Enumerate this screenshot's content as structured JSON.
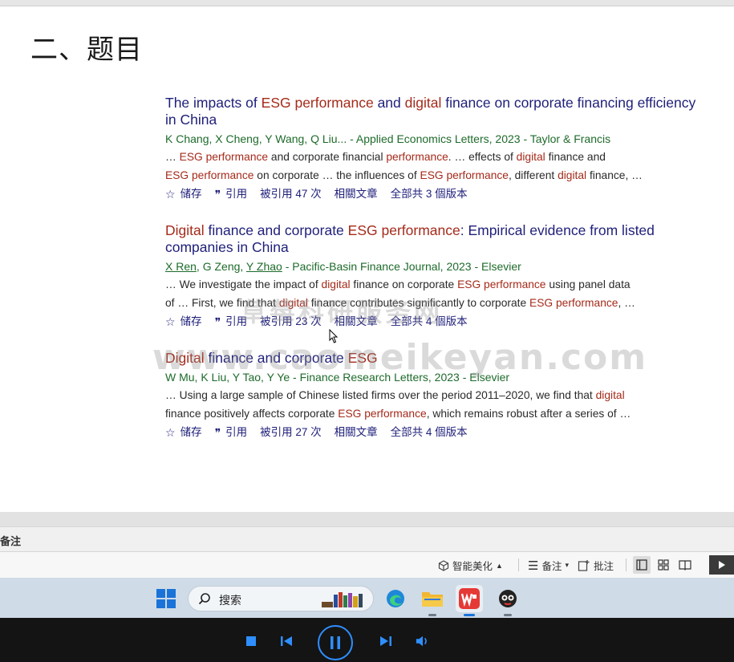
{
  "slide": {
    "title": "二、题目",
    "watermark_url": "www.caomeikeyan.com",
    "watermark_cn": "草莓科研服务网",
    "results": [
      {
        "title_parts": [
          {
            "t": "The impacts of ",
            "hl": false
          },
          {
            "t": "ESG performance",
            "hl": true
          },
          {
            "t": " and ",
            "hl": false
          },
          {
            "t": "digital",
            "hl": true
          },
          {
            "t": " finance on corporate financing efficiency in China",
            "hl": false
          }
        ],
        "authors_parts": [
          {
            "t": "K Chang, X Cheng, Y Wang, Q Liu... - Applied Economics Letters, 2023 - Taylor & Francis",
            "u": false
          }
        ],
        "snippet_line1": [
          {
            "t": "… ",
            "hl": false
          },
          {
            "t": "ESG performance",
            "hl": true
          },
          {
            "t": " and corporate financial ",
            "hl": false
          },
          {
            "t": "performance",
            "hl": true
          },
          {
            "t": ". … effects of ",
            "hl": false
          },
          {
            "t": "digital",
            "hl": true
          },
          {
            "t": " finance and",
            "hl": false
          }
        ],
        "snippet_line2": [
          {
            "t": "ESG performance",
            "hl": true
          },
          {
            "t": " on corporate … the influences of ",
            "hl": false
          },
          {
            "t": "ESG performance",
            "hl": true
          },
          {
            "t": ", different ",
            "hl": false
          },
          {
            "t": "digital",
            "hl": true
          },
          {
            "t": " finance, …",
            "hl": false
          }
        ],
        "links": {
          "save": "储存",
          "cite": "引用",
          "cited_by": "被引用 47 次",
          "related": "相關文章",
          "versions": "全部共 3 個版本"
        }
      },
      {
        "title_parts": [
          {
            "t": "Digital",
            "hl": true
          },
          {
            "t": " finance and corporate ",
            "hl": false
          },
          {
            "t": "ESG performance",
            "hl": true
          },
          {
            "t": ": Empirical evidence from listed companies in China",
            "hl": false
          }
        ],
        "authors_parts": [
          {
            "t": "X Ren",
            "u": true
          },
          {
            "t": ", G Zeng, ",
            "u": false
          },
          {
            "t": "Y Zhao",
            "u": true
          },
          {
            "t": " - Pacific-Basin Finance Journal, 2023 - Elsevier",
            "u": false
          }
        ],
        "snippet_line1": [
          {
            "t": "… We investigate the impact of ",
            "hl": false
          },
          {
            "t": "digital",
            "hl": true
          },
          {
            "t": " finance on corporate ",
            "hl": false
          },
          {
            "t": "ESG performance",
            "hl": true
          },
          {
            "t": " using panel data",
            "hl": false
          }
        ],
        "snippet_line2": [
          {
            "t": "of … First, we find that ",
            "hl": false
          },
          {
            "t": "digital",
            "hl": true
          },
          {
            "t": " finance contributes significantly to corporate ",
            "hl": false
          },
          {
            "t": "ESG performance",
            "hl": true
          },
          {
            "t": ", …",
            "hl": false
          }
        ],
        "links": {
          "save": "储存",
          "cite": "引用",
          "cited_by": "被引用 23 次",
          "related": "相關文章",
          "versions": "全部共 4 個版本"
        }
      },
      {
        "title_parts": [
          {
            "t": "Digital",
            "hl": true
          },
          {
            "t": " finance and corporate ",
            "hl": false
          },
          {
            "t": "ESG",
            "hl": true
          }
        ],
        "authors_parts": [
          {
            "t": "W Mu, K Liu, Y Tao, Y Ye - Finance Research Letters, 2023 - Elsevier",
            "u": false
          }
        ],
        "snippet_line1": [
          {
            "t": "… Using a large sample of Chinese listed firms over the period 2011–2020, we find that ",
            "hl": false
          },
          {
            "t": "digital",
            "hl": true
          }
        ],
        "snippet_line2": [
          {
            "t": "finance positively affects corporate ",
            "hl": false
          },
          {
            "t": "ESG performance",
            "hl": true
          },
          {
            "t": ", which remains robust after a series of …",
            "hl": false
          }
        ],
        "links": {
          "save": "储存",
          "cite": "引用",
          "cited_by": "被引用 27 次",
          "related": "相關文章",
          "versions": "全部共 4 個版本"
        }
      }
    ]
  },
  "notes": {
    "label": "备注"
  },
  "status_bar": {
    "smart_beautify": "智能美化",
    "notes_btn": "备注",
    "annotate_btn": "批注"
  },
  "taskbar": {
    "search_placeholder": "搜索",
    "apps": [
      "edge-icon",
      "file-explorer-icon",
      "wps-icon",
      "chat-app-icon"
    ]
  },
  "colors": {
    "highlight": "#a52a1a",
    "title": "#1f1f7a",
    "authors": "#1e6b2b",
    "media_accent": "#2f8fff"
  }
}
